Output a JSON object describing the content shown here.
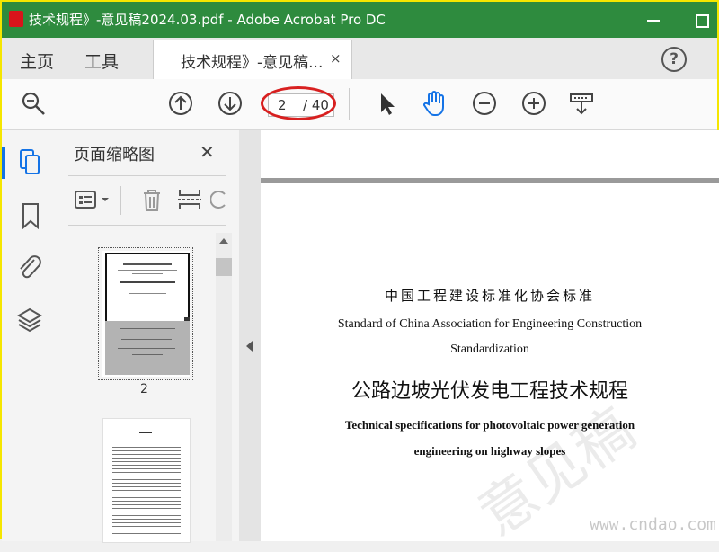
{
  "window": {
    "title": "技术规程》-意见稿2024.03.pdf - Adobe Acrobat Pro DC"
  },
  "menu": {
    "home": "主页",
    "tools": "工具"
  },
  "tab": {
    "label": "技术规程》-意见稿...",
    "close": "×"
  },
  "toolbar": {
    "page_current": "2",
    "page_total": "/ 40"
  },
  "thumbnails": {
    "title": "页面缩略图",
    "close": "✕",
    "page_label": "2"
  },
  "document": {
    "org_cn": "中国工程建设标准化协会标准",
    "org_en_1": "Standard of China Association for Engineering Construction",
    "org_en_2": "Standardization",
    "title_cn": "公路边坡光伏发电工程技术规程",
    "title_en_1": "Technical specifications for photovoltaic power generation",
    "title_en_2": "engineering on highway slopes",
    "watermark": "意见稿",
    "site_watermark": "www.cndao.com"
  },
  "colors": {
    "titlebar": "#2e8b3e",
    "accent": "#1473e6",
    "annotation": "#d82020"
  }
}
